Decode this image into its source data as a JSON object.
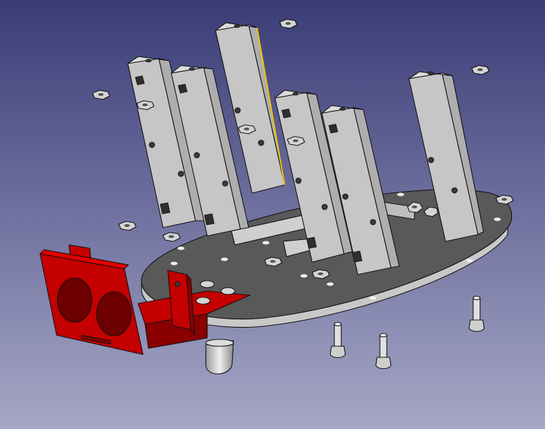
{
  "scene": {
    "background_top": "#3a3c78",
    "background_bottom": "#a6a7c6",
    "plate_top_color": "#595959",
    "plate_rim_color": "#c8c8c8",
    "pillar_front_color": "#c6c6c6",
    "pillar_side_color": "#aeaeae",
    "pillar_top_color": "#dcdcdc",
    "bracket_color": "#c40000",
    "bracket_dark_color": "#8a0000",
    "selection_edge_color": "#f0c400",
    "hardware_color": "#d4d4d4"
  },
  "parts": {
    "base_plate": "base-plate",
    "pillars": [
      "pillar-1",
      "pillar-2",
      "pillar-3",
      "pillar-4",
      "pillar-5",
      "pillar-6"
    ],
    "sensor_bracket": "ultrasonic-sensor-bracket",
    "caster": "caster-wheel",
    "nuts": 16,
    "screws": 3
  }
}
